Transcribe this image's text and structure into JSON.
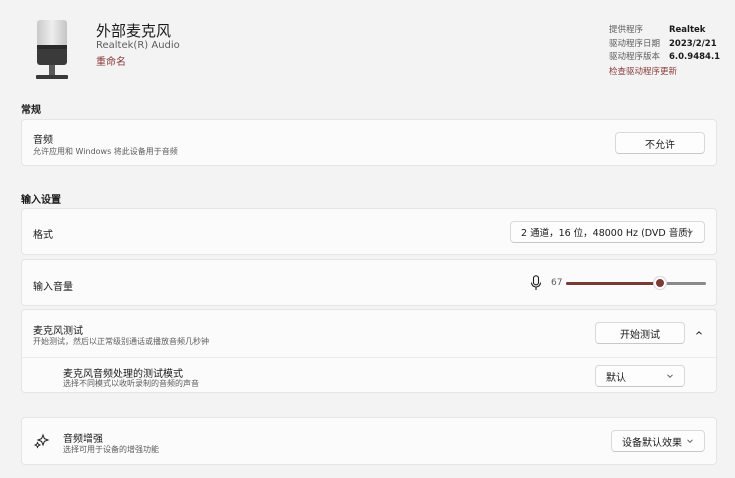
{
  "device": {
    "name": "外部麦克风",
    "driver_label": "Realtek(R) Audio",
    "rename_link": "重命名",
    "icon": "microphone-device-image"
  },
  "driver_info": {
    "provider_label": "提供程序",
    "provider_value": "Realtek",
    "date_label": "驱动程序日期",
    "date_value": "2023/2/21",
    "version_label": "驱动程序版本",
    "version_value": "6.0.9484.1",
    "update_link": "检查驱动程序更新"
  },
  "general": {
    "section_title": "常规",
    "audio_title": "音频",
    "audio_desc": "允许应用和 Windows 将此设备用于音频",
    "audio_button": "不允许"
  },
  "input_settings": {
    "section_title": "输入设置",
    "format_title": "格式",
    "format_value": "2 通道，16 位，48000 Hz (DVD 音质)",
    "volume_title": "输入音量",
    "volume_value": "67",
    "volume_level": 67,
    "mic_test_title": "麦克风测试",
    "mic_test_desc": "开始测试，然后以正常级别通话或播放音频几秒钟",
    "mic_test_button": "开始测试",
    "test_mode_title": "麦克风音频处理的测试模式",
    "test_mode_desc": "选择不同模式以收听录制的音频的声音",
    "test_mode_value": "默认"
  },
  "enhancements": {
    "title": "音频增强",
    "desc": "选择可用于设备的增强功能",
    "value": "设备默认效果",
    "icon": "sparkle-icon"
  },
  "colors": {
    "accent": "#7a3b35",
    "link": "#8a3b3b",
    "background": "#f3f3f3",
    "card": "#fbfbfb"
  }
}
